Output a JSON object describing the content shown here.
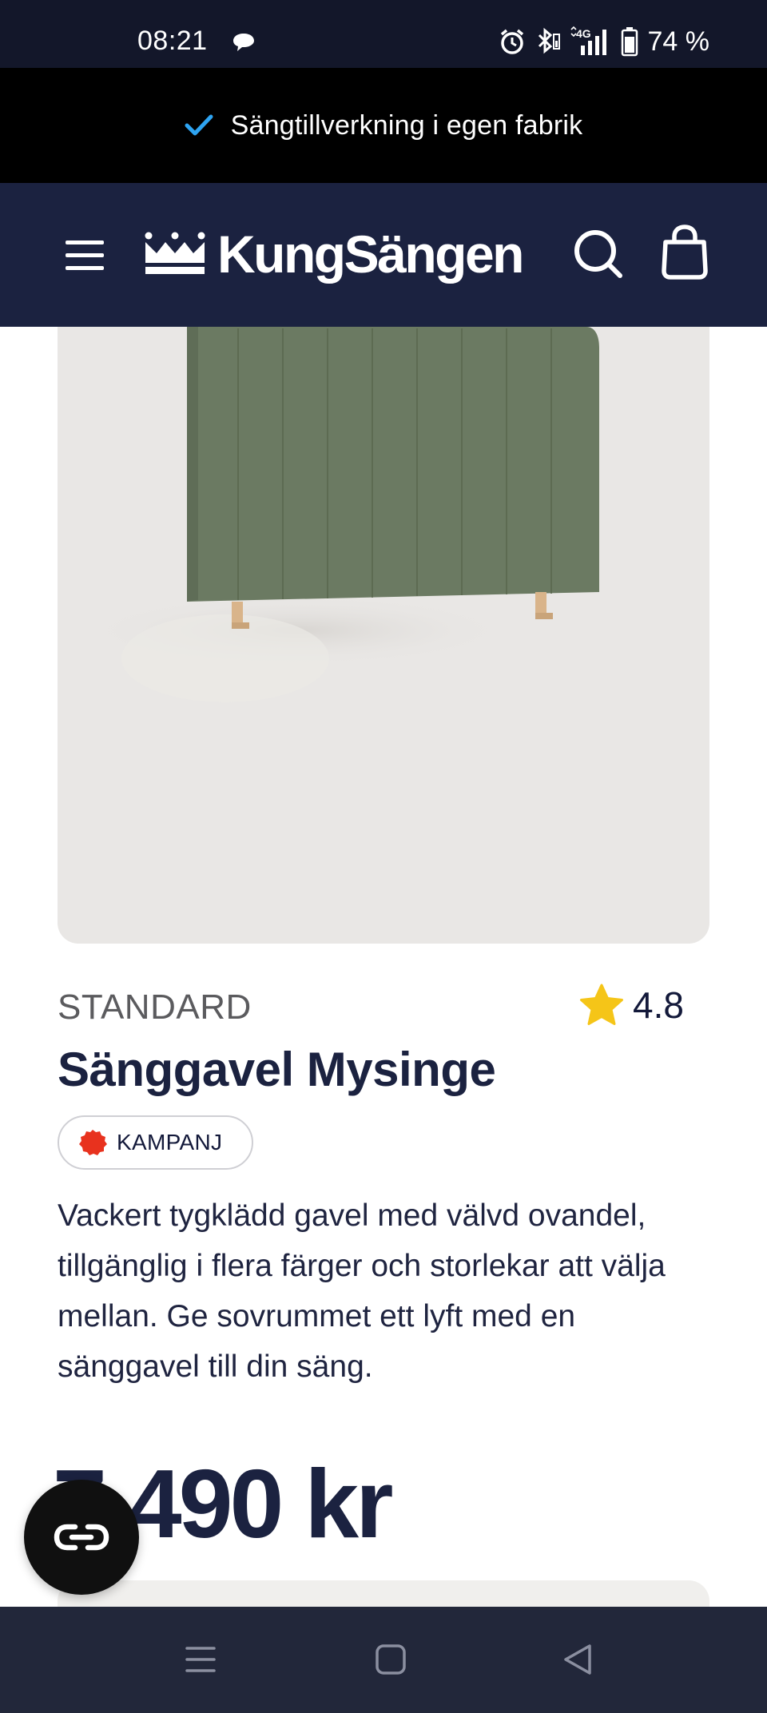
{
  "status_bar": {
    "time": "08:21",
    "battery": "74 %",
    "network": "4G",
    "icons": [
      "chat-bubble-icon",
      "alarm-icon",
      "bluetooth-icon",
      "signal-icon",
      "battery-icon"
    ]
  },
  "promo": {
    "text": "Sängtillverkning i egen fabrik",
    "icon": "checkmark-icon",
    "icon_color": "#2ea4f2"
  },
  "header": {
    "logo_text": "KungSängen",
    "logo_icon": "crown-icon",
    "background": "#1b2240",
    "icons": [
      "hamburger-menu-icon",
      "search-icon",
      "shopping-bag-icon"
    ]
  },
  "product": {
    "category": "STANDARD",
    "rating": "4.8",
    "rating_icon": "star-icon",
    "rating_color": "#f5c518",
    "title": "Sänggavel Mysinge",
    "badge": "KAMPANJ",
    "badge_color": "#e8321e",
    "description": "Vackert tygklädd gavel med välvd ovandel, tillgänglig i flera färger och storlekar att välja mellan. Ge sovrummet ett lyft med en sänggavel till din säng.",
    "price": "7 490 kr",
    "headboard_color": "#6b7a62"
  },
  "chat_button": {
    "icon": "chat-loop-icon"
  },
  "nav_bar": {
    "icons": [
      "recents-icon",
      "home-icon",
      "back-icon"
    ]
  }
}
